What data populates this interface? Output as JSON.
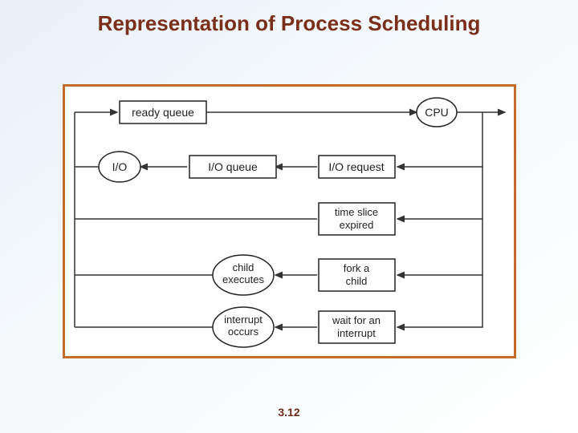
{
  "title": "Representation of Process Scheduling",
  "page_number": "3.12",
  "nodes": {
    "ready_queue": "ready queue",
    "cpu": "CPU",
    "io": "I/O",
    "io_queue": "I/O queue",
    "io_request": "I/O request",
    "time_slice_l1": "time slice",
    "time_slice_l2": "expired",
    "child_exec_l1": "child",
    "child_exec_l2": "executes",
    "fork_l1": "fork a",
    "fork_l2": "child",
    "interrupt_occ_l1": "interrupt",
    "interrupt_occ_l2": "occurs",
    "wait_int_l1": "wait for an",
    "wait_int_l2": "interrupt"
  }
}
